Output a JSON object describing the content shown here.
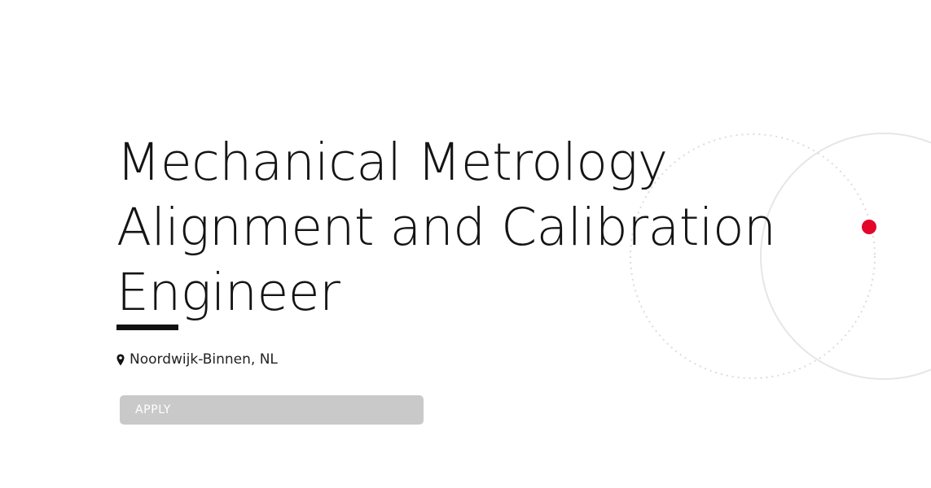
{
  "job": {
    "title_lines": [
      "Mechanical Metrology",
      "Alignment and Calibration",
      "Engineer"
    ],
    "location": "Noordwijk-Binnen, NL"
  },
  "actions": {
    "apply_label": "APPLY"
  },
  "icons": {
    "location": "map-pin-icon"
  },
  "colors": {
    "accent": "#e3062a",
    "button_bg": "#c9c9c9",
    "text": "#141414",
    "ring": "#e2e2e2"
  }
}
